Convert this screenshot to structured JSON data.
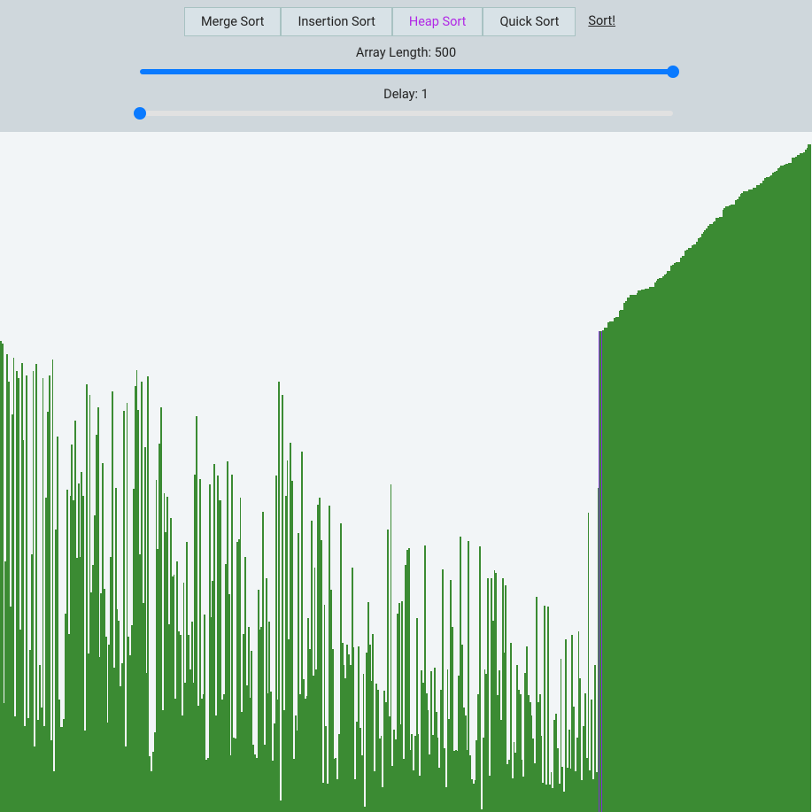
{
  "controls": {
    "buttons": {
      "merge": "Merge Sort",
      "insertion": "Insertion Sort",
      "heap": "Heap Sort",
      "quick": "Quick Sort"
    },
    "active_button": "heap",
    "sort_link": "Sort!",
    "array_length": {
      "label_prefix": "Array Length: ",
      "value": 500,
      "min": 10,
      "max": 500
    },
    "delay": {
      "label_prefix": "Delay: ",
      "value": 1,
      "min": 1,
      "max": 1000
    }
  },
  "chart_data": {
    "type": "bar",
    "title": "",
    "xlabel": "",
    "ylabel": "",
    "ylim": [
      0,
      600
    ],
    "bar_color": "#3b8b33",
    "pivot_index": 370,
    "description": "Heap sort in progress: left ~74% unsorted random bars with a rough descending envelope; right ~26% sorted ascending staircase.",
    "values": [
      416,
      413,
      96,
      221,
      404,
      380,
      181,
      351,
      401,
      84,
      389,
      383,
      161,
      396,
      328,
      76,
      385,
      83,
      143,
      227,
      389,
      58,
      395,
      81,
      130,
      92,
      383,
      76,
      277,
      353,
      385,
      63,
      399,
      36,
      249,
      331,
      99,
      75,
      75,
      82,
      175,
      284,
      157,
      279,
      324,
      275,
      345,
      224,
      290,
      225,
      300,
      279,
      72,
      377,
      140,
      368,
      194,
      218,
      262,
      333,
      357,
      137,
      193,
      308,
      197,
      155,
      79,
      148,
      225,
      371,
      127,
      286,
      179,
      169,
      111,
      131,
      354,
      58,
      361,
      155,
      138,
      165,
      285,
      376,
      390,
      355,
      227,
      380,
      184,
      322,
      123,
      384,
      49,
      36,
      53,
      70,
      293,
      232,
      325,
      357,
      90,
      281,
      247,
      278,
      166,
      259,
      208,
      209,
      100,
      221,
      159,
      156,
      85,
      202,
      114,
      238,
      156,
      126,
      168,
      114,
      298,
      349,
      94,
      294,
      100,
      104,
      174,
      46,
      48,
      289,
      172,
      204,
      307,
      85,
      297,
      275,
      275,
      99,
      104,
      219,
      309,
      192,
      50,
      298,
      66,
      65,
      238,
      241,
      277,
      88,
      157,
      225,
      112,
      163,
      101,
      142,
      59,
      51,
      48,
      196,
      161,
      163,
      265,
      59,
      206,
      105,
      168,
      106,
      45,
      78,
      297,
      99,
      380,
      10,
      368,
      90,
      279,
      310,
      152,
      326,
      292,
      47,
      85,
      72,
      246,
      104,
      318,
      117,
      100,
      102,
      171,
      144,
      257,
      120,
      216,
      126,
      271,
      277,
      240,
      26,
      183,
      76,
      25,
      270,
      196,
      144,
      47,
      48,
      29,
      69,
      255,
      149,
      130,
      118,
      148,
      139,
      130,
      216,
      145,
      29,
      80,
      146,
      74,
      50,
      122,
      5,
      141,
      185,
      148,
      116,
      157,
      36,
      113,
      108,
      65,
      67,
      22,
      107,
      97,
      249,
      84,
      289,
      41,
      73,
      64,
      175,
      184,
      77,
      186,
      47,
      218,
      231,
      233,
      55,
      69,
      37,
      67,
      171,
      69,
      32,
      125,
      114,
      235,
      105,
      90,
      51,
      124,
      68,
      127,
      88,
      66,
      39,
      108,
      214,
      56,
      22,
      126,
      82,
      205,
      163,
      54,
      55,
      54,
      120,
      243,
      148,
      92,
      85,
      55,
      239,
      50,
      29,
      25,
      28,
      63,
      104,
      234,
      2,
      66,
      126,
      122,
      206,
      32,
      206,
      169,
      213,
      211,
      103,
      125,
      81,
      206,
      141,
      200,
      42,
      46,
      149,
      30,
      62,
      52,
      130,
      108,
      104,
      46,
      31,
      123,
      146,
      103,
      97,
      85,
      65,
      43,
      190,
      97,
      104,
      67,
      26,
      182,
      24,
      181,
      24,
      35,
      21,
      81,
      87,
      56,
      25,
      135,
      40,
      18,
      152,
      39,
      73,
      38,
      156,
      93,
      36,
      66,
      159,
      118,
      28,
      76,
      105,
      48,
      264,
      37,
      99,
      29,
      130,
      35,
      286,
      424,
      425,
      427,
      427,
      432,
      433,
      433,
      433,
      436,
      437,
      437,
      442,
      443,
      443,
      449,
      451,
      454,
      454,
      456,
      456,
      456,
      456,
      458,
      460,
      460,
      461,
      461,
      462,
      462,
      462,
      463,
      463,
      463,
      467,
      469,
      470,
      471,
      471,
      473,
      474,
      475,
      477,
      477,
      482,
      483,
      484,
      485,
      485,
      485,
      489,
      491,
      491,
      495,
      496,
      498,
      498,
      500,
      501,
      501,
      503,
      506,
      507,
      510,
      512,
      513,
      515,
      517,
      519,
      519,
      520,
      521,
      524,
      524,
      525,
      525,
      531,
      533,
      534,
      534,
      535,
      536,
      536,
      536,
      540,
      541,
      543,
      545,
      546,
      548,
      548,
      548,
      549,
      549,
      549,
      551,
      551,
      553,
      553,
      555,
      555,
      557,
      559,
      560,
      560,
      561,
      562,
      564,
      565,
      566,
      568,
      569,
      570,
      570,
      571,
      572,
      572,
      573,
      573,
      577,
      577,
      578,
      580,
      580,
      581,
      581,
      582,
      584,
      586,
      589,
      589
    ]
  }
}
